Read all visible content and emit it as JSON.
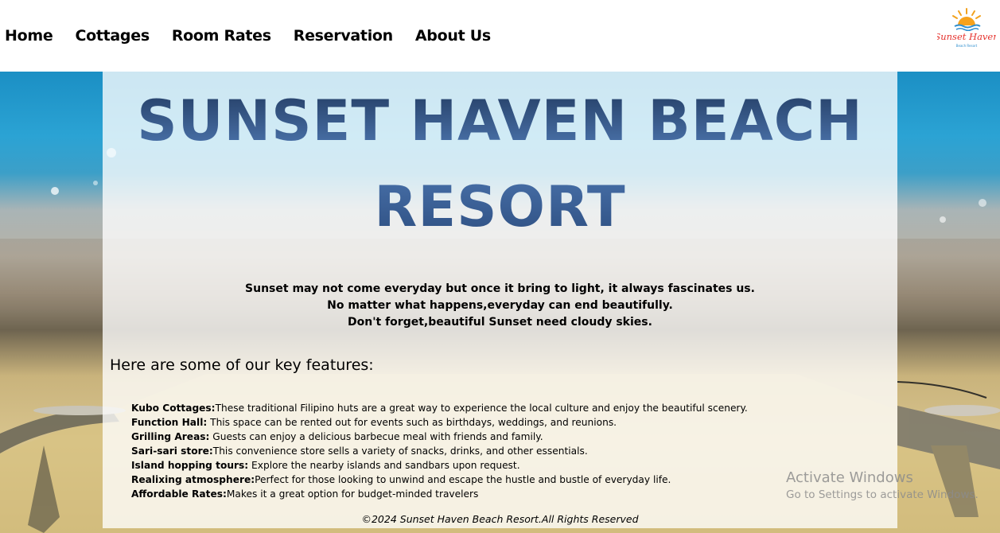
{
  "nav": {
    "items": [
      "Home",
      "Cottages",
      "Room Rates",
      "Reservation",
      "About Us"
    ]
  },
  "logo": {
    "name": "Sunset Haven",
    "tagline": "Beach Resort"
  },
  "hero": {
    "title_line1": "SUNSET HAVEN BEACH",
    "title_line2": "RESORT",
    "quote_lines": [
      "Sunset may not come everyday but once it bring to light, it always fascinates us.",
      "No matter what happens,everyday can end beautifully.",
      "Don't forget,beautiful Sunset need cloudy skies."
    ]
  },
  "features": {
    "heading": "Here are some of our key features:",
    "items": [
      {
        "name": "Kubo Cottages:",
        "desc": "These traditional Filipino huts are a great way to experience the local culture and enjoy the beautiful scenery."
      },
      {
        "name": "Function Hall:",
        "desc": " This space can be rented out for events such as birthdays, weddings, and reunions."
      },
      {
        "name": "Grilling Areas:",
        "desc": " Guests can enjoy a delicious barbecue meal with friends and family."
      },
      {
        "name": "Sari-sari store:",
        "desc": "This convenience store sells a variety of snacks, drinks, and other essentials."
      },
      {
        "name": "Island hopping tours:",
        "desc": " Explore the nearby islands and sandbars upon request."
      },
      {
        "name": "Realixing atmosphere:",
        "desc": "Perfect for those looking to unwind and escape the hustle and bustle of everyday life."
      },
      {
        "name": "Affordable Rates:",
        "desc": "Makes it a great option for budget-minded travelers"
      }
    ]
  },
  "footer": {
    "text": "©2024 Sunset Haven Beach Resort.All Rights Reserved"
  },
  "watermark": {
    "line1": "Activate Windows",
    "line2": "Go to Settings to activate Windows."
  },
  "colors": {
    "title_gradient_dark": "#1d3458",
    "title_gradient_light": "#4f79b3",
    "sea": "#1b8fc4",
    "sand": "#d8c48d",
    "logo_orange": "#f07d1a",
    "logo_red": "#e5322d",
    "logo_blue": "#2f8fcf"
  }
}
